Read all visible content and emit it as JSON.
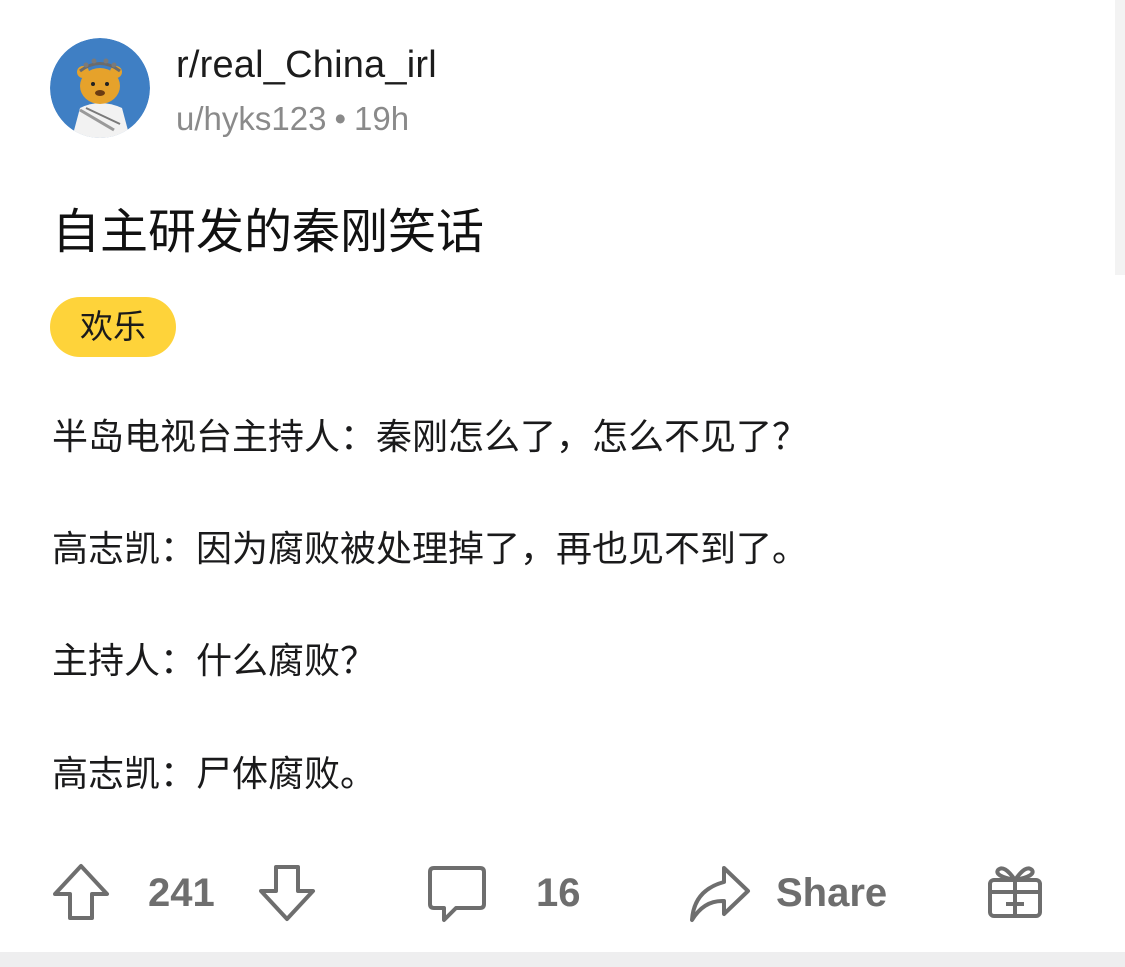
{
  "post": {
    "subreddit": "r/real_China_irl",
    "author": "u/hyks123",
    "separator": "•",
    "time": "19h",
    "title": "自主研发的秦刚笑话",
    "flair": "欢乐",
    "body": [
      "半岛电视台主持人：秦刚怎么了，怎么不见了？",
      "高志凯：因为腐败被处理掉了，再也见不到了。",
      "主持人：什么腐败？",
      "高志凯：尸体腐败。"
    ]
  },
  "actions": {
    "upvotes": "241",
    "comments": "16",
    "share_label": "Share"
  },
  "colors": {
    "flair_bg": "#fed33a",
    "icon_gray": "#6e6e6e",
    "avatar_bg": "#3f7fc4"
  },
  "icons": [
    "upvote-icon",
    "downvote-icon",
    "comment-icon",
    "share-icon",
    "award-icon"
  ]
}
